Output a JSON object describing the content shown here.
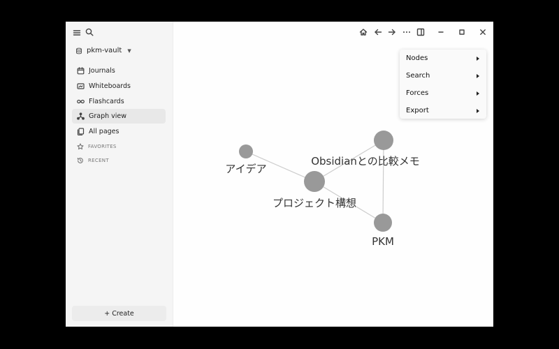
{
  "sidebar": {
    "vault_name": "pkm-vault",
    "items": [
      {
        "label": "Journals",
        "icon": "calendar-icon",
        "active": false
      },
      {
        "label": "Whiteboards",
        "icon": "whiteboard-icon",
        "active": false
      },
      {
        "label": "Flashcards",
        "icon": "infinity-icon",
        "active": false
      },
      {
        "label": "Graph view",
        "icon": "graph-icon",
        "active": true
      },
      {
        "label": "All pages",
        "icon": "pages-icon",
        "active": false
      }
    ],
    "sections": {
      "favorites": "FAVORITES",
      "recent": "RECENT"
    },
    "create_label": "+ Create"
  },
  "graph": {
    "nodes": [
      {
        "id": "idea",
        "label": "アイデア"
      },
      {
        "id": "project",
        "label": "プロジェクト構想"
      },
      {
        "id": "obsidian",
        "label": "Obsidianとの比較メモ"
      },
      {
        "id": "pkm",
        "label": "PKM"
      }
    ],
    "edges": [
      [
        "idea",
        "project"
      ],
      [
        "project",
        "obsidian"
      ],
      [
        "project",
        "pkm"
      ],
      [
        "obsidian",
        "pkm"
      ]
    ],
    "node_color": "#999999",
    "edge_color": "#cccccc"
  },
  "menu": {
    "items": [
      "Nodes",
      "Search",
      "Forces",
      "Export"
    ]
  },
  "help_label": "?"
}
